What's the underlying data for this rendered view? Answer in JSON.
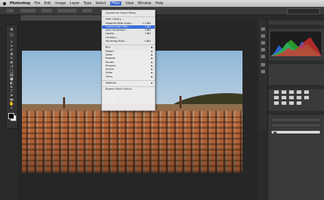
{
  "menubar": {
    "apple": "",
    "items": [
      "Photoshop",
      "File",
      "Edit",
      "Image",
      "Layer",
      "Type",
      "Select",
      "Filter",
      "View",
      "Window",
      "Help"
    ],
    "active": "Filter"
  },
  "filter_menu": {
    "groups": [
      [
        {
          "label": "Convert for Smart Filters",
          "shortcut": "",
          "submenu": false
        }
      ],
      [
        {
          "label": "Filter Gallery...",
          "shortcut": "",
          "submenu": false
        },
        {
          "label": "Adaptive Wide Angle...",
          "shortcut": "⌥⇧⌘A",
          "submenu": false
        },
        {
          "label": "Camera Raw Filter...",
          "shortcut": "⇧⌘A",
          "submenu": false,
          "highlighted": true
        },
        {
          "label": "Lens Correction...",
          "shortcut": "⇧⌘R",
          "submenu": false
        },
        {
          "label": "Liquify...",
          "shortcut": "⇧⌘X",
          "submenu": false
        },
        {
          "label": "Oil Paint...",
          "shortcut": "",
          "submenu": false
        },
        {
          "label": "Vanishing Point...",
          "shortcut": "⌥⌘V",
          "submenu": false
        }
      ],
      [
        {
          "label": "Blur",
          "shortcut": "",
          "submenu": true
        },
        {
          "label": "Distort",
          "shortcut": "",
          "submenu": true
        },
        {
          "label": "Noise",
          "shortcut": "",
          "submenu": true
        },
        {
          "label": "Pixelate",
          "shortcut": "",
          "submenu": true
        },
        {
          "label": "Render",
          "shortcut": "",
          "submenu": true
        },
        {
          "label": "Sharpen",
          "shortcut": "",
          "submenu": true
        },
        {
          "label": "Stylize",
          "shortcut": "",
          "submenu": true
        },
        {
          "label": "Video",
          "shortcut": "",
          "submenu": true
        },
        {
          "label": "Other",
          "shortcut": "",
          "submenu": true
        }
      ],
      [
        {
          "label": "Digimarc",
          "shortcut": "",
          "submenu": true
        }
      ],
      [
        {
          "label": "Browse Filters Online...",
          "shortcut": "",
          "submenu": false
        }
      ]
    ]
  },
  "icons": {
    "apple": "apple-logo-icon",
    "submenu": "triangle-right-icon",
    "tools": [
      "move-icon",
      "marquee-icon",
      "lasso-icon",
      "quick-select-icon",
      "crop-icon",
      "eyedropper-icon",
      "healing-icon",
      "brush-icon",
      "clone-icon",
      "history-brush-icon",
      "eraser-icon",
      "gradient-icon",
      "blur-icon",
      "dodge-icon",
      "pen-icon",
      "type-icon",
      "path-select-icon",
      "shape-icon",
      "hand-icon",
      "zoom-icon"
    ]
  },
  "colors": {
    "menu_highlight": "#3a6ed8",
    "interface_bg": "#2a2a2a",
    "histogram_red": "#e03030",
    "histogram_green": "#30c030",
    "histogram_blue": "#3070ff"
  }
}
